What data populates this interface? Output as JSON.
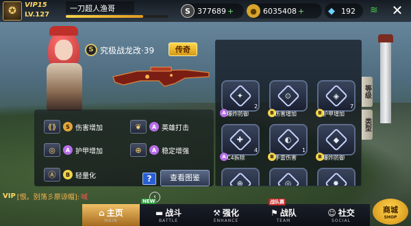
{
  "player": {
    "vip": "VIP15",
    "level": "LV.127",
    "name": "一刀超人渔哥",
    "exp_fraction": 0.75
  },
  "resources": {
    "silver": "377689",
    "gold": "6035408",
    "diamond": "192"
  },
  "weapon": {
    "rank_letter": "S",
    "name": "究极战龙改·39",
    "tag": "传奇"
  },
  "bonuses": [
    {
      "icon": "flame-icon",
      "grade": "S",
      "label": "伤害增加"
    },
    {
      "icon": "wings-icon",
      "grade": "A",
      "label": "英雄打击"
    },
    {
      "icon": "armor-icon",
      "grade": "A",
      "label": "护甲增加"
    },
    {
      "icon": "crosshair-icon",
      "grade": "A",
      "label": "稳定增强"
    },
    {
      "icon": "lightweight-icon",
      "grade": "B",
      "label": "轻量化"
    }
  ],
  "buttons": {
    "help": "?",
    "view_gallery": "查看图鉴"
  },
  "parts": [
    {
      "symbol": "✦",
      "grade": "A",
      "label": "爆炸防御",
      "count": "2"
    },
    {
      "symbol": "⊙",
      "grade": "B",
      "label": "伤害增加",
      "count": ""
    },
    {
      "symbol": "◈",
      "grade": "B",
      "label": "护甲增加",
      "count": "7"
    },
    {
      "symbol": "✚",
      "grade": "A",
      "label": "C4拆除",
      "count": "4"
    },
    {
      "symbol": "◐",
      "grade": "B",
      "label": "手雷伤害",
      "count": "1"
    },
    {
      "symbol": "◆",
      "grade": "B",
      "label": "爆炸防御",
      "count": ""
    },
    {
      "symbol": "⊕",
      "grade": "",
      "label": "",
      "count": ""
    },
    {
      "symbol": "◎",
      "grade": "",
      "label": "",
      "count": ""
    },
    {
      "symbol": "✸",
      "grade": "",
      "label": "",
      "count": ""
    }
  ],
  "side_tabs": {
    "level": "等级",
    "type": "类型"
  },
  "chat": {
    "vip": "VIP",
    "message": "[恨。别荡彡原谅帽]:",
    "link": "喊"
  },
  "nav": [
    {
      "icon": "home-icon",
      "glyph": "⌂",
      "label": "主页",
      "sub": "MAIN",
      "active": true,
      "badge": ""
    },
    {
      "icon": "gun-icon",
      "glyph": "▬",
      "label": "战斗",
      "sub": "BATTLE",
      "active": false,
      "badge": "NEW"
    },
    {
      "icon": "hammer-icon",
      "glyph": "⚒",
      "label": "强化",
      "sub": "ENHANCE",
      "active": false,
      "badge": ""
    },
    {
      "icon": "team-icon",
      "glyph": "⚑",
      "label": "战队",
      "sub": "TEAM",
      "active": false,
      "badge": "战队赛"
    },
    {
      "icon": "social-icon",
      "glyph": "☺",
      "label": "社交",
      "sub": "SOCIAL",
      "active": false,
      "badge": ""
    }
  ],
  "shop": {
    "label": "商城",
    "sub": "SHOP"
  },
  "colors": {
    "accent_gold": "#ffd54d",
    "grade_s": "#e2a53a",
    "grade_a": "#b56ee6",
    "grade_b": "#f0d34c",
    "wifi": "#46d046"
  }
}
